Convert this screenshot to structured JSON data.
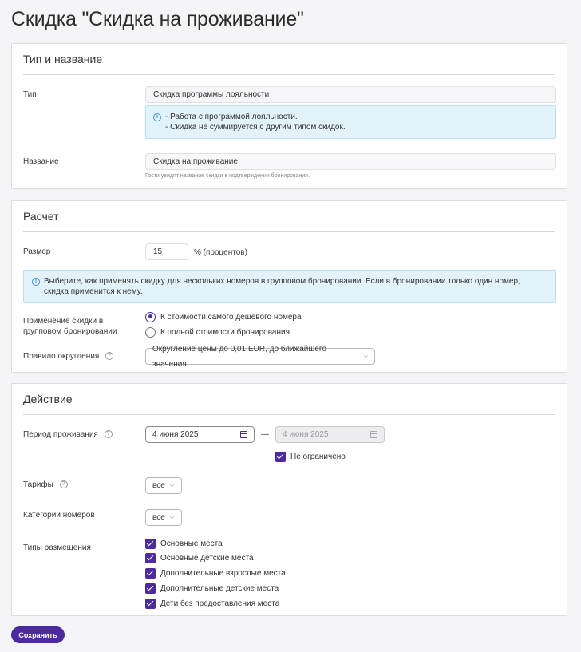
{
  "page": {
    "title": "Скидка \"Скидка на проживание\""
  },
  "type_section": {
    "title": "Тип и название",
    "type_label": "Тип",
    "type_value": "Скидка программы лояльности",
    "info_line1": "- Работа с программой лояльности.",
    "info_line2": "- Скидка не суммируется с другим типом скидок.",
    "name_label": "Название",
    "name_value": "Скидка на проживание",
    "name_hint": "Гости увидят название скидки в подтверждении бронирования."
  },
  "calc_section": {
    "title": "Расчет",
    "size_label": "Размер",
    "size_value": "15",
    "size_unit": "% (процентов)",
    "info_text": "Выберите, как применять скидку для нескольких номеров в групповом бронировании. Если в бронировании только один номер, скидка применится к нему.",
    "group_label_line1": "Применение скидки в",
    "group_label_line2": "групповом бронировании",
    "option_cheapest": "К стоимости самого дешевого номера",
    "option_full": "К полной стоимости бронирования",
    "selected_option": "cheapest",
    "rounding_label": "Правило округления",
    "rounding_value": "Округление цены до 0,01 EUR, до ближайшего значения"
  },
  "action_section": {
    "title": "Действие",
    "period_label": "Период проживания",
    "date_from": "4 июня 2025",
    "date_separator": "—",
    "date_to": "4 июня 2025",
    "unlimited_label": "Не ограничено",
    "unlimited_checked": true,
    "tariffs_label": "Тарифы",
    "tariffs_value": "все",
    "categories_label": "Категории номеров",
    "categories_value": "все",
    "placement_label": "Типы размещения",
    "placement_options": [
      {
        "label": "Основные места",
        "checked": true
      },
      {
        "label": "Основные детские места",
        "checked": true
      },
      {
        "label": "Дополнительные взрослые места",
        "checked": true
      },
      {
        "label": "Дополнительные детские места",
        "checked": true
      },
      {
        "label": "Дети без предоставления места",
        "checked": true
      }
    ]
  },
  "save_label": "Сохранить",
  "icons": {
    "info": "info-icon",
    "help": "help-icon",
    "calendar": "calendar-icon",
    "chevron": "chevron-down-icon"
  },
  "colors": {
    "accent": "#4b2b9f",
    "info_bg": "#e2f3fb",
    "info_border": "#b9dff1",
    "info_icon": "#3d8fd6"
  }
}
